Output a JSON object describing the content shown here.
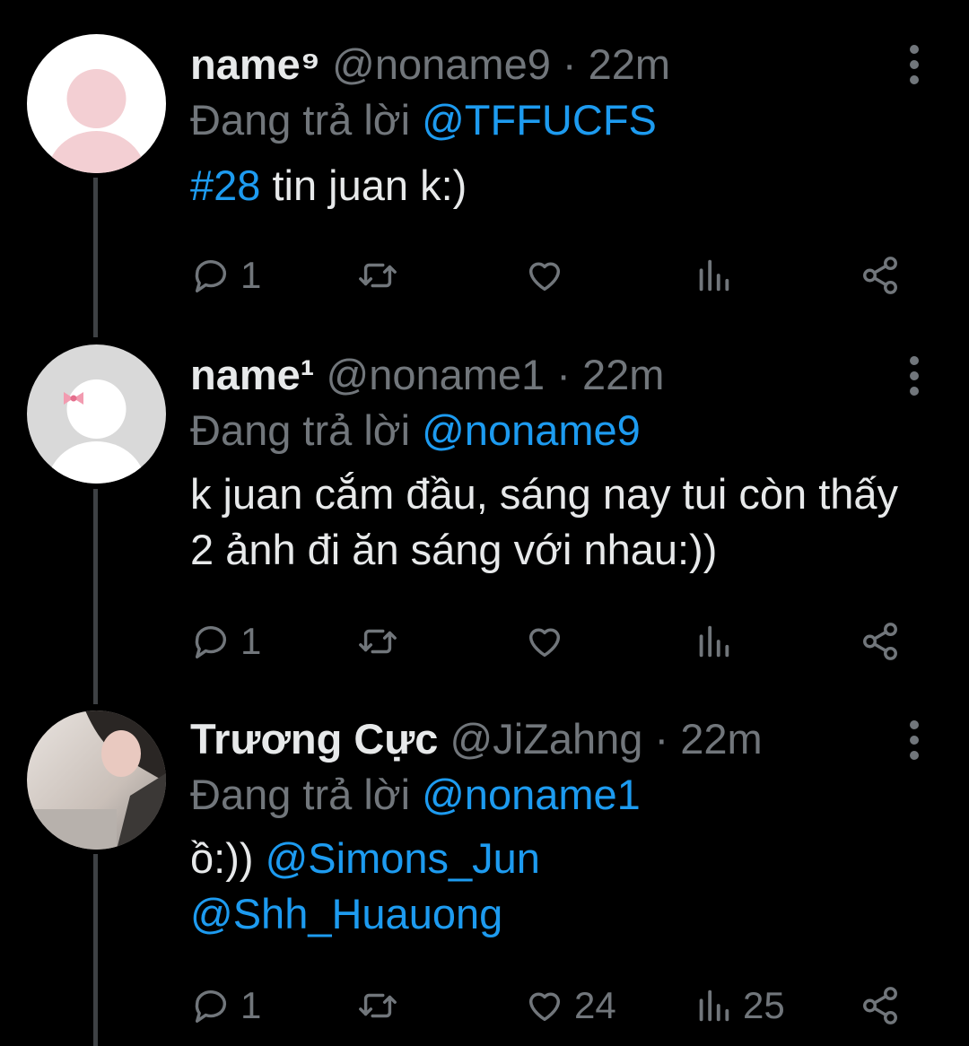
{
  "colors": {
    "background": "#000000",
    "text": "#e7e9ea",
    "secondary": "#71767b",
    "link": "#1d9bf0",
    "thread": "#3e4144"
  },
  "tweets": [
    {
      "display_name": "name⁹",
      "handle": "@noname9",
      "time": "· 22m",
      "reply_prefix": "Đang trả lời",
      "reply_to": "@TFFUCFS",
      "body_hashtag": "#28",
      "body_text": " tin juan k:)",
      "reply_count": "1",
      "retweet_count": "",
      "like_count": "",
      "view_count": "",
      "avatar": "default-pink-avatar"
    },
    {
      "display_name": "name¹",
      "handle": "@noname1",
      "time": "· 22m",
      "reply_prefix": "Đang trả lời",
      "reply_to": "@noname9",
      "body_text": "k juan cắm đầu, sáng nay tui còn thấy 2 ảnh đi ăn sáng với nhau:))",
      "reply_count": "1",
      "retweet_count": "",
      "like_count": "",
      "view_count": "",
      "avatar": "default-grey-avatar-with-bow"
    },
    {
      "display_name": "Trương Cực",
      "handle": "@JiZahng",
      "time": "· 22m",
      "reply_prefix": "Đang trả lời",
      "reply_to": "@noname1",
      "body_text": "ồ:)) ",
      "body_mention_1": "@Simons_Jun",
      "body_mention_2": "@Shh_Huauong",
      "reply_count": "1",
      "retweet_count": "",
      "like_count": "24",
      "view_count": "25",
      "avatar": "photo-avatar"
    }
  ]
}
